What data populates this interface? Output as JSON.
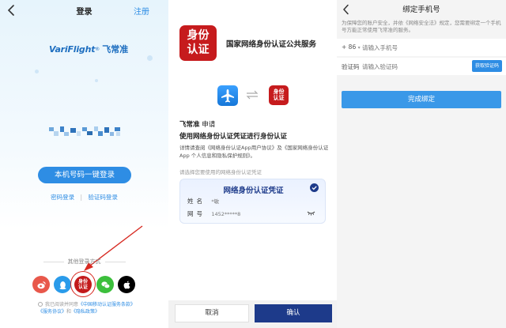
{
  "login": {
    "title": "登录",
    "register": "注册",
    "logo_en": "VariFlight",
    "logo_mark": "®",
    "logo_cn": "飞常准",
    "one_click_login": "本机号码一键登录",
    "password_login": "密码登录",
    "code_login": "验证码登录",
    "other_methods": "其他登录方式",
    "social_idcard_text": "身份认证",
    "agree_text_1": "我已阅读并同意",
    "agree_link_1": "《中国移动认证服务条款》",
    "agree_text_2": "和",
    "agree_link_2": "《服务协议》",
    "agree_text_3": "、",
    "agree_link_3": "《隐私政策》",
    "colors": {
      "primary": "#2e8de4",
      "highlight": "#d72a22"
    }
  },
  "auth": {
    "logo_line1": "身份",
    "logo_line2": "认证",
    "service_name": "国家网络身份认证公共服务",
    "small_logo_line1": "身份",
    "small_logo_line2": "认证",
    "applicant": "飞常准",
    "apply_word": "申请",
    "use_text": "使用网络身份认证凭证进行身份认证",
    "details": "详情请查阅《网络身份认证App用户协议》及《国家网络身份认证App 个人信息和隐私保护规则》。",
    "select_hint": "请选择您要使用的网络身份认证凭证",
    "card": {
      "title": "网络身份认证凭证",
      "name_label": "姓名",
      "name_value": "*敏",
      "id_label": "网号",
      "id_value": "1452*****8"
    },
    "cancel": "取消",
    "confirm": "确认",
    "colors": {
      "brand_red": "#c61b1d",
      "navy": "#1d3a8a"
    }
  },
  "bind": {
    "title": "绑定手机号",
    "note": "为保障您的账户安全，并依《网络安全法》规定，您需要绑定一个手机号方能正常使用飞常准的服务。",
    "country_code": "+ 86",
    "phone_placeholder": "请输入手机号",
    "code_label": "验证码",
    "code_placeholder": "请输入验证码",
    "get_code": "获取验证码",
    "done": "完成绑定",
    "colors": {
      "button": "#3a98e8"
    }
  }
}
